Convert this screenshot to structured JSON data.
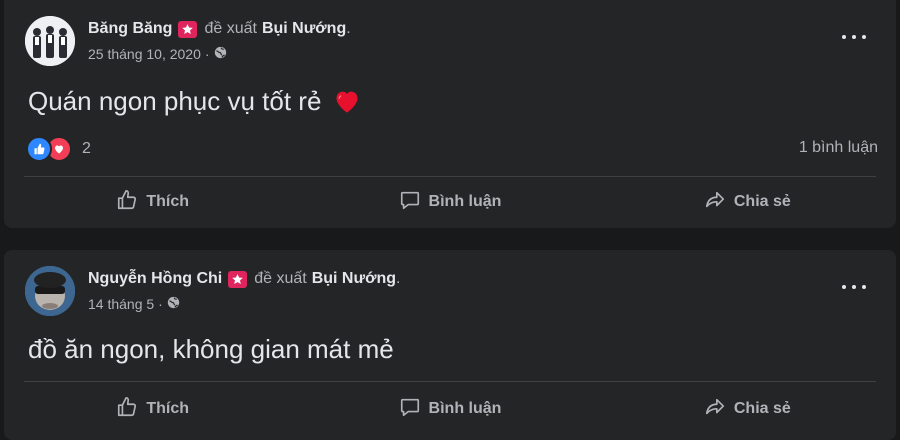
{
  "posts": [
    {
      "author": "Băng Băng",
      "recommends_text": "đề xuất",
      "target": "Bụi Nướng",
      "date": "25 tháng 10, 2020",
      "privacy_icon": "globe-icon",
      "text": "Quán ngon phục vụ tốt rẻ",
      "emoji": "heart",
      "reaction_count": "2",
      "comment_count": "1 bình luận",
      "actions": {
        "like": "Thích",
        "comment": "Bình luận",
        "share": "Chia sẻ"
      }
    },
    {
      "author": "Nguyễn Hồng Chi",
      "recommends_text": "đề xuất",
      "target": "Bụi Nướng",
      "date": "14 tháng 5",
      "privacy_icon": "globe-icon",
      "text": "đồ ăn ngon, không gian mát mẻ",
      "actions": {
        "like": "Thích",
        "comment": "Bình luận",
        "share": "Chia sẻ"
      }
    }
  ],
  "colors": {
    "background": "#18191a",
    "card": "#242526",
    "primary_text": "#e4e6eb",
    "secondary_text": "#b0b3b8",
    "like_blue": "#2d88ff",
    "love_red": "#f33e58",
    "recommend_badge": "#e0245e"
  }
}
